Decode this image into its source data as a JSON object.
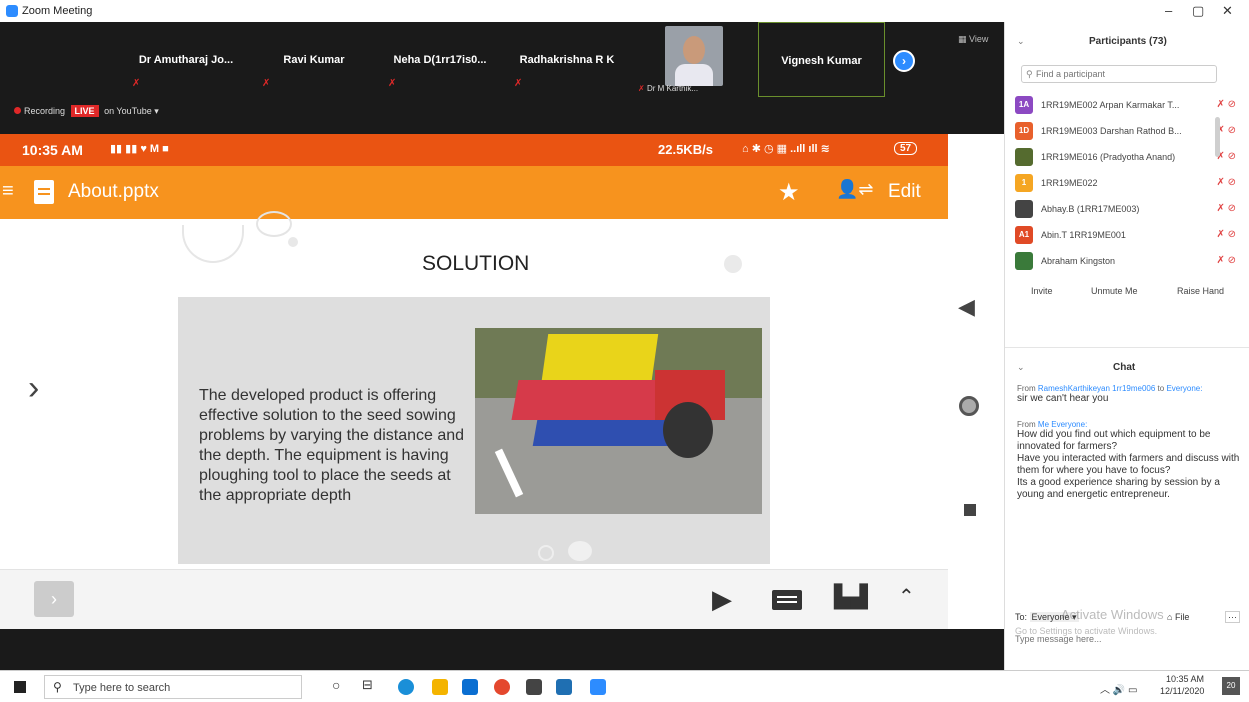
{
  "window": {
    "title": "Zoom Meeting",
    "controls": [
      "–",
      "▢",
      "✕"
    ]
  },
  "meeting": {
    "participants_tiles": [
      {
        "name": "Dr Amutharaj Jo..."
      },
      {
        "name": "Ravi Kumar"
      },
      {
        "name": "Neha D(1rr17is0..."
      },
      {
        "name": "Radhakrishna R K"
      }
    ],
    "video_tile_name": "Dr M Karthik...",
    "active_speaker": "Vignesh Kumar",
    "view_label": "View",
    "recording": {
      "label": "Recording",
      "live_badge": "LIVE",
      "platform": "on YouTube ▾"
    }
  },
  "phone": {
    "status_time": "10:35 AM",
    "status_right": "22.5KB/s",
    "battery": "57",
    "file_name": "About.pptx",
    "edit_label": "Edit",
    "slide": {
      "title": "SOLUTION",
      "body": "The developed product is offering effective solution to the seed sowing problems by varying the distance and the depth. The equipment is having ploughing tool to place the seeds at the appropriate depth"
    }
  },
  "sidebar": {
    "participants_header": "Participants (73)",
    "search_placeholder": "Find a participant",
    "participants": [
      {
        "initials": "1A",
        "color": "#8c49c2",
        "name": "1RR19ME002 Arpan Karmakar T..."
      },
      {
        "initials": "1D",
        "color": "#e8602c",
        "name": "1RR19ME003 Darshan Rathod B..."
      },
      {
        "initials": "",
        "color": "#556b2f",
        "name": "1RR19ME016 (Pradyotha Anand)"
      },
      {
        "initials": "1",
        "color": "#f5a623",
        "name": "1RR19ME022"
      },
      {
        "initials": "",
        "color": "#444444",
        "name": "Abhay.B (1RR17ME003)"
      },
      {
        "initials": "A1",
        "color": "#e04a26",
        "name": "Abin.T 1RR19ME001"
      },
      {
        "initials": "",
        "color": "#3a7a3a",
        "name": "Abraham Kingston"
      }
    ],
    "buttons": {
      "invite": "Invite",
      "unmute": "Unmute Me",
      "raise_hand": "Raise Hand"
    },
    "chat_header": "Chat",
    "chat": [
      {
        "from": "From",
        "sender": "RameshKarthikeyan 1rr19me006",
        "to_word": "to",
        "to": "Everyone:",
        "text": "sir we can't hear you"
      },
      {
        "from": "From",
        "sender": "Me",
        "to_word": "to",
        "to": "Everyone:",
        "text": "How did you find out which equipment to be innovated for farmers?\nHave you interacted with farmers and discuss with them for where you have to focus?\nIts a good experience sharing by session by a young and energetic entrepreneur."
      }
    ],
    "chat_to_label": "To:",
    "chat_to_value": "Everyone ▾",
    "file_label": "File",
    "more_label": "···",
    "chat_placeholder": "Type message here...",
    "watermark_line1": "Activate Windows",
    "watermark_line2": "Go to Settings to activate Windows."
  },
  "taskbar": {
    "search_placeholder": "Type here to search",
    "time": "10:35 AM",
    "date": "12/11/2020",
    "notification_count": "20"
  },
  "colors": {
    "zoom_blue": "#2d8cff",
    "status_orange": "#ea5412",
    "app_orange": "#f7931e",
    "record_red": "#e02828"
  }
}
